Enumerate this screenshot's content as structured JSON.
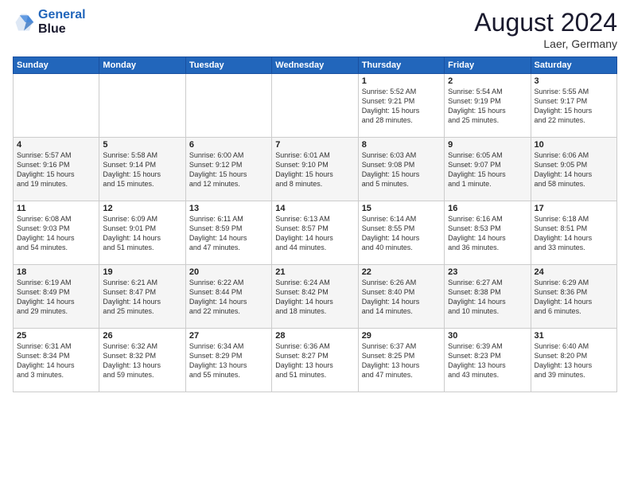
{
  "header": {
    "logo_line1": "General",
    "logo_line2": "Blue",
    "month_title": "August 2024",
    "location": "Laer, Germany"
  },
  "days_of_week": [
    "Sunday",
    "Monday",
    "Tuesday",
    "Wednesday",
    "Thursday",
    "Friday",
    "Saturday"
  ],
  "weeks": [
    [
      {
        "day": "",
        "info": ""
      },
      {
        "day": "",
        "info": ""
      },
      {
        "day": "",
        "info": ""
      },
      {
        "day": "",
        "info": ""
      },
      {
        "day": "1",
        "info": "Sunrise: 5:52 AM\nSunset: 9:21 PM\nDaylight: 15 hours\nand 28 minutes."
      },
      {
        "day": "2",
        "info": "Sunrise: 5:54 AM\nSunset: 9:19 PM\nDaylight: 15 hours\nand 25 minutes."
      },
      {
        "day": "3",
        "info": "Sunrise: 5:55 AM\nSunset: 9:17 PM\nDaylight: 15 hours\nand 22 minutes."
      }
    ],
    [
      {
        "day": "4",
        "info": "Sunrise: 5:57 AM\nSunset: 9:16 PM\nDaylight: 15 hours\nand 19 minutes."
      },
      {
        "day": "5",
        "info": "Sunrise: 5:58 AM\nSunset: 9:14 PM\nDaylight: 15 hours\nand 15 minutes."
      },
      {
        "day": "6",
        "info": "Sunrise: 6:00 AM\nSunset: 9:12 PM\nDaylight: 15 hours\nand 12 minutes."
      },
      {
        "day": "7",
        "info": "Sunrise: 6:01 AM\nSunset: 9:10 PM\nDaylight: 15 hours\nand 8 minutes."
      },
      {
        "day": "8",
        "info": "Sunrise: 6:03 AM\nSunset: 9:08 PM\nDaylight: 15 hours\nand 5 minutes."
      },
      {
        "day": "9",
        "info": "Sunrise: 6:05 AM\nSunset: 9:07 PM\nDaylight: 15 hours\nand 1 minute."
      },
      {
        "day": "10",
        "info": "Sunrise: 6:06 AM\nSunset: 9:05 PM\nDaylight: 14 hours\nand 58 minutes."
      }
    ],
    [
      {
        "day": "11",
        "info": "Sunrise: 6:08 AM\nSunset: 9:03 PM\nDaylight: 14 hours\nand 54 minutes."
      },
      {
        "day": "12",
        "info": "Sunrise: 6:09 AM\nSunset: 9:01 PM\nDaylight: 14 hours\nand 51 minutes."
      },
      {
        "day": "13",
        "info": "Sunrise: 6:11 AM\nSunset: 8:59 PM\nDaylight: 14 hours\nand 47 minutes."
      },
      {
        "day": "14",
        "info": "Sunrise: 6:13 AM\nSunset: 8:57 PM\nDaylight: 14 hours\nand 44 minutes."
      },
      {
        "day": "15",
        "info": "Sunrise: 6:14 AM\nSunset: 8:55 PM\nDaylight: 14 hours\nand 40 minutes."
      },
      {
        "day": "16",
        "info": "Sunrise: 6:16 AM\nSunset: 8:53 PM\nDaylight: 14 hours\nand 36 minutes."
      },
      {
        "day": "17",
        "info": "Sunrise: 6:18 AM\nSunset: 8:51 PM\nDaylight: 14 hours\nand 33 minutes."
      }
    ],
    [
      {
        "day": "18",
        "info": "Sunrise: 6:19 AM\nSunset: 8:49 PM\nDaylight: 14 hours\nand 29 minutes."
      },
      {
        "day": "19",
        "info": "Sunrise: 6:21 AM\nSunset: 8:47 PM\nDaylight: 14 hours\nand 25 minutes."
      },
      {
        "day": "20",
        "info": "Sunrise: 6:22 AM\nSunset: 8:44 PM\nDaylight: 14 hours\nand 22 minutes."
      },
      {
        "day": "21",
        "info": "Sunrise: 6:24 AM\nSunset: 8:42 PM\nDaylight: 14 hours\nand 18 minutes."
      },
      {
        "day": "22",
        "info": "Sunrise: 6:26 AM\nSunset: 8:40 PM\nDaylight: 14 hours\nand 14 minutes."
      },
      {
        "day": "23",
        "info": "Sunrise: 6:27 AM\nSunset: 8:38 PM\nDaylight: 14 hours\nand 10 minutes."
      },
      {
        "day": "24",
        "info": "Sunrise: 6:29 AM\nSunset: 8:36 PM\nDaylight: 14 hours\nand 6 minutes."
      }
    ],
    [
      {
        "day": "25",
        "info": "Sunrise: 6:31 AM\nSunset: 8:34 PM\nDaylight: 14 hours\nand 3 minutes."
      },
      {
        "day": "26",
        "info": "Sunrise: 6:32 AM\nSunset: 8:32 PM\nDaylight: 13 hours\nand 59 minutes."
      },
      {
        "day": "27",
        "info": "Sunrise: 6:34 AM\nSunset: 8:29 PM\nDaylight: 13 hours\nand 55 minutes."
      },
      {
        "day": "28",
        "info": "Sunrise: 6:36 AM\nSunset: 8:27 PM\nDaylight: 13 hours\nand 51 minutes."
      },
      {
        "day": "29",
        "info": "Sunrise: 6:37 AM\nSunset: 8:25 PM\nDaylight: 13 hours\nand 47 minutes."
      },
      {
        "day": "30",
        "info": "Sunrise: 6:39 AM\nSunset: 8:23 PM\nDaylight: 13 hours\nand 43 minutes."
      },
      {
        "day": "31",
        "info": "Sunrise: 6:40 AM\nSunset: 8:20 PM\nDaylight: 13 hours\nand 39 minutes."
      }
    ]
  ]
}
